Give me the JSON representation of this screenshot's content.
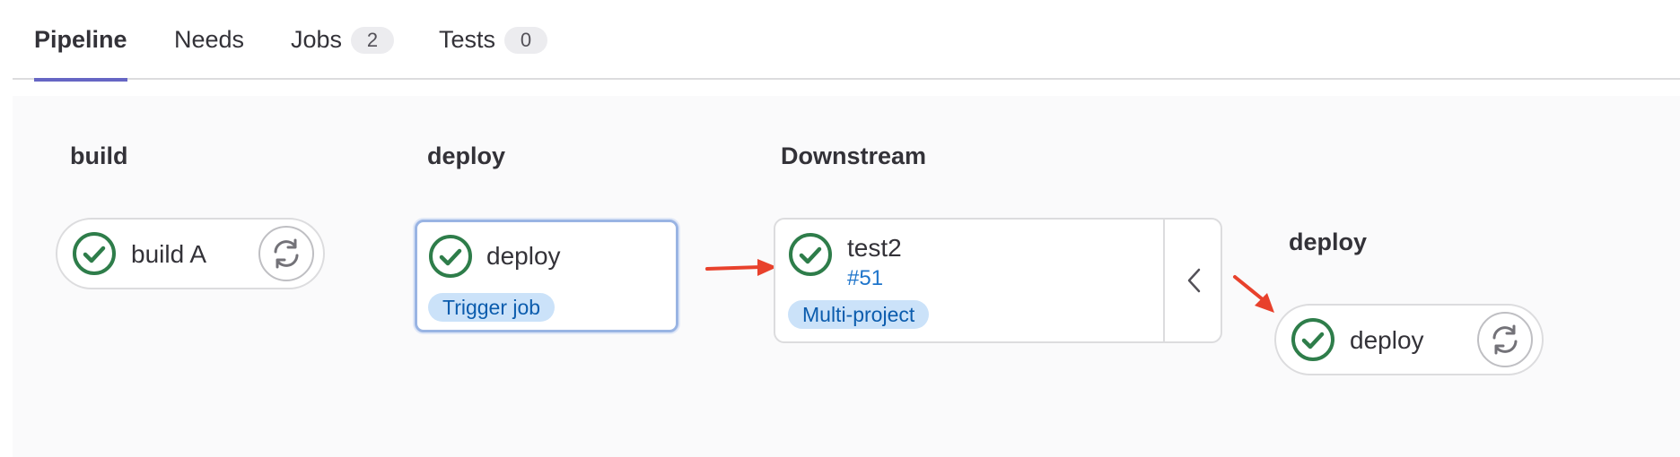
{
  "tabs": [
    {
      "label": "Pipeline",
      "active": true
    },
    {
      "label": "Needs"
    },
    {
      "label": "Jobs",
      "count": "2"
    },
    {
      "label": "Tests",
      "count": "0"
    }
  ],
  "stages": [
    {
      "title": "build",
      "jobs": [
        {
          "name": "build A",
          "status": "success-icon",
          "action": "retry-icon"
        }
      ]
    },
    {
      "title": "deploy",
      "jobs": [
        {
          "name": "deploy",
          "status": "success-icon",
          "tag": "Trigger job"
        }
      ]
    },
    {
      "title": "Downstream",
      "pipelines": [
        {
          "name": "test2",
          "id": "#51",
          "status": "success-icon",
          "tag": "Multi-project",
          "action": "chevron-left-icon"
        }
      ]
    },
    {
      "title": "deploy",
      "jobs": [
        {
          "name": "deploy",
          "status": "success-icon",
          "action": "retry-icon"
        }
      ]
    }
  ],
  "colors": {
    "success": "#2e7d4a",
    "active_tab": "#6666c4",
    "arrow": "#e8412c",
    "link": "#1f75cb",
    "tag_bg": "#cbe2f9",
    "tag_text": "#0b5cad"
  }
}
